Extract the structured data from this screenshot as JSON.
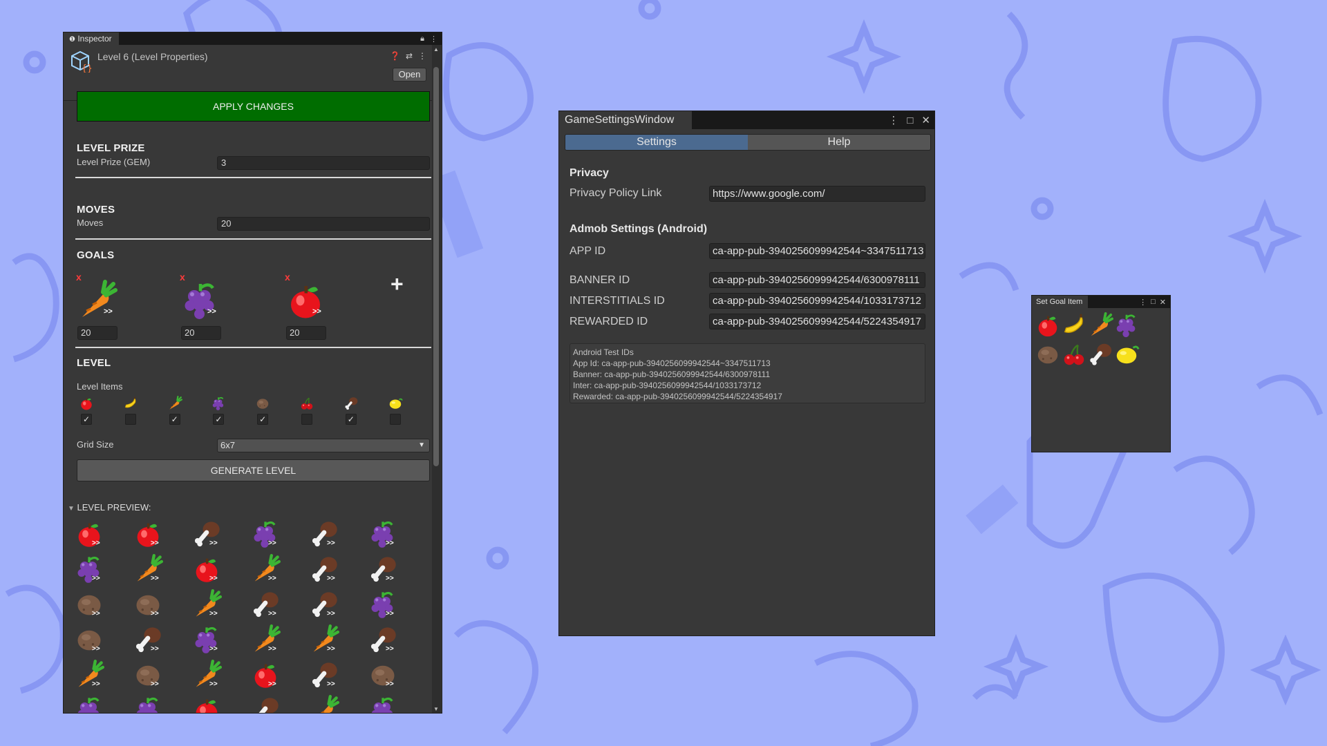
{
  "colors": {
    "background": "#a2b1fb",
    "apply_button": "#006d00",
    "goal_remove": "#ff3b3b",
    "active_tab": "#4b6a90"
  },
  "inspector": {
    "tab_title": "Inspector",
    "asset_title": "Level 6 (Level Properties)",
    "open_label": "Open",
    "apply_label": "APPLY CHANGES",
    "level_prize": {
      "section": "LEVEL PRIZE",
      "label": "Level Prize (GEM)",
      "value": "3"
    },
    "moves": {
      "section": "MOVES",
      "label": "Moves",
      "value": "20"
    },
    "goals": {
      "section": "GOALS",
      "remove_label": "x",
      "arrow_label": ">>",
      "items": [
        {
          "icon": "carrot",
          "count": "20"
        },
        {
          "icon": "grape",
          "count": "20"
        },
        {
          "icon": "apple",
          "count": "20"
        }
      ],
      "add_label": "+"
    },
    "level": {
      "section": "LEVEL",
      "items_label": "Level Items",
      "items": [
        {
          "icon": "apple",
          "checked": true
        },
        {
          "icon": "banana",
          "checked": false
        },
        {
          "icon": "carrot",
          "checked": true
        },
        {
          "icon": "grape",
          "checked": true
        },
        {
          "icon": "potato",
          "checked": true
        },
        {
          "icon": "cherry",
          "checked": false
        },
        {
          "icon": "drumstick",
          "checked": true
        },
        {
          "icon": "lemon",
          "checked": false
        }
      ],
      "check_mark": "✓",
      "grid_label": "Grid Size",
      "grid_value": "6x7",
      "generate_label": "GENERATE LEVEL"
    },
    "preview": {
      "title": "LEVEL PREVIEW:",
      "arrow_label": ">>",
      "rows": [
        [
          "apple",
          "apple",
          "drumstick",
          "grape",
          "drumstick",
          "grape"
        ],
        [
          "grape",
          "carrot",
          "apple",
          "carrot",
          "drumstick",
          "drumstick"
        ],
        [
          "potato",
          "potato",
          "carrot",
          "drumstick",
          "drumstick",
          "grape"
        ],
        [
          "potato",
          "drumstick",
          "grape",
          "carrot",
          "carrot",
          "drumstick"
        ],
        [
          "carrot",
          "potato",
          "carrot",
          "apple",
          "drumstick",
          "potato"
        ],
        [
          "grape",
          "grape",
          "apple",
          "drumstick",
          "carrot",
          "grape"
        ]
      ]
    }
  },
  "game_settings": {
    "tab_title": "GameSettingsWindow",
    "tabs": [
      "Settings",
      "Help"
    ],
    "privacy_head": "Privacy",
    "privacy_label": "Privacy Policy Link",
    "privacy_value": "https://www.google.com/",
    "admob_head": "Admob Settings (Android)",
    "fields": [
      {
        "label": "APP ID",
        "value": "ca-app-pub-3940256099942544~3347511713"
      },
      {
        "label": "BANNER ID",
        "value": "ca-app-pub-3940256099942544/6300978111"
      },
      {
        "label": "INTERSTITIALS ID",
        "value": "ca-app-pub-3940256099942544/1033173712"
      },
      {
        "label": "REWARDED ID",
        "value": "ca-app-pub-3940256099942544/5224354917"
      }
    ],
    "help_lines": [
      "Android Test IDs",
      "App Id: ca-app-pub-3940256099942544~3347511713",
      "Banner: ca-app-pub-3940256099942544/6300978111",
      "Inter: ca-app-pub-3940256099942544/1033173712",
      "Rewarded: ca-app-pub-3940256099942544/5224354917"
    ]
  },
  "set_goal": {
    "tab_title": "Set Goal Item",
    "items": [
      "apple",
      "banana",
      "carrot",
      "grape",
      "potato",
      "cherry",
      "drumstick",
      "lemon"
    ]
  }
}
